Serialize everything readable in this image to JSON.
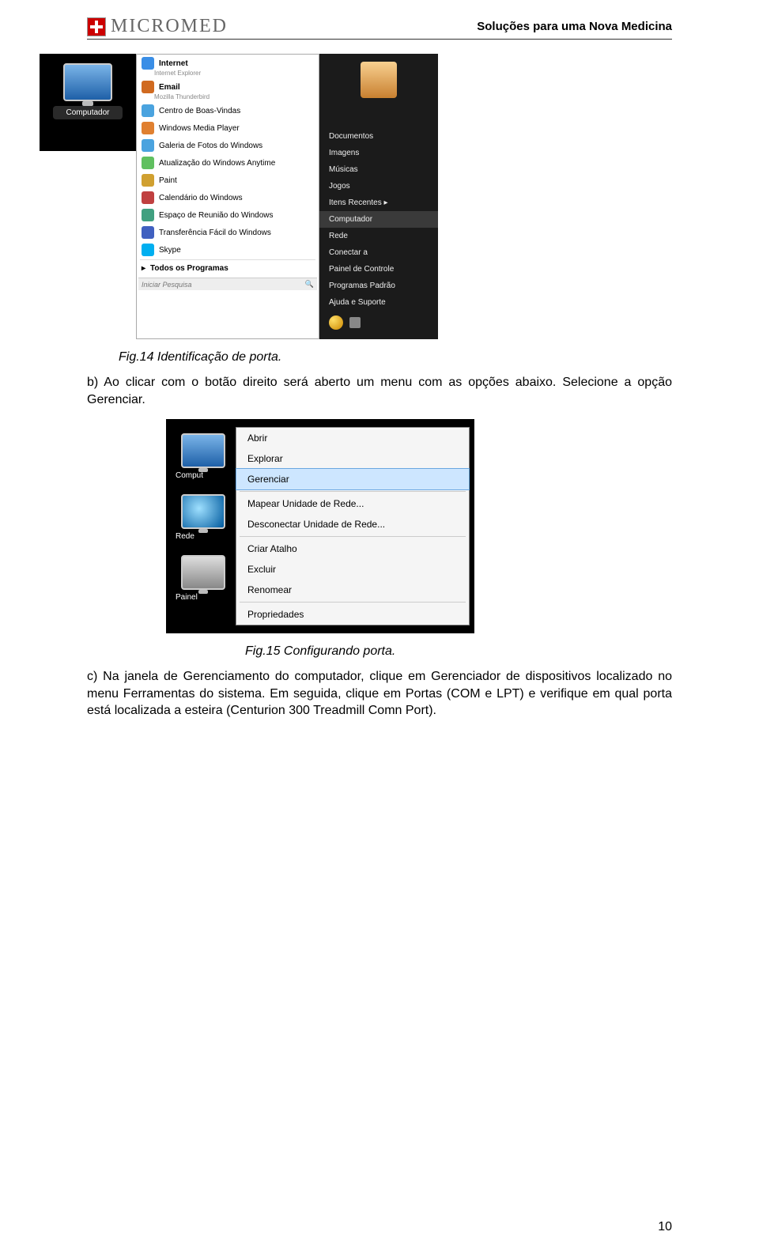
{
  "header": {
    "brand": "MICROMED",
    "tagline": "Soluções para uma Nova Medicina"
  },
  "fig14": {
    "sidebar_label": "Computador",
    "left_items": [
      {
        "title": "Internet",
        "sub": "Internet Explorer",
        "color": "#3a8ee6"
      },
      {
        "title": "Email",
        "sub": "Mozilla Thunderbird",
        "color": "#d06a20"
      },
      {
        "title": "Centro de Boas-Vindas",
        "color": "#4aa3df"
      },
      {
        "title": "Windows Media Player",
        "color": "#e08030"
      },
      {
        "title": "Galeria de Fotos do Windows",
        "color": "#4aa3df"
      },
      {
        "title": "Atualização do Windows Anytime",
        "color": "#60c060"
      },
      {
        "title": "Paint",
        "color": "#d0a030"
      },
      {
        "title": "Calendário do Windows",
        "color": "#c04040"
      },
      {
        "title": "Espaço de Reunião do Windows",
        "color": "#40a080"
      },
      {
        "title": "Transferência Fácil do Windows",
        "color": "#4060c0"
      },
      {
        "title": "Skype",
        "color": "#00aff0"
      }
    ],
    "all_programs": "Todos os Programas",
    "search_placeholder": "Iniciar Pesquisa",
    "right_items": [
      "Documentos",
      "Imagens",
      "Músicas",
      "Jogos",
      "Itens Recentes",
      "Computador",
      "Rede",
      "Conectar a",
      "Painel de Controle",
      "Programas Padrão",
      "Ajuda e Suporte"
    ],
    "right_selected_index": 5,
    "caption": "Fig.14 Identificação de porta."
  },
  "para_b": "b) Ao clicar com o botão direito será aberto um menu com as opções abaixo. Selecione a opção Gerenciar.",
  "fig15": {
    "left_labels": [
      "Comput",
      "Rede",
      "Painel"
    ],
    "ctx_groups": [
      [
        "Abrir",
        "Explorar",
        "Gerenciar"
      ],
      [
        "Mapear Unidade de Rede...",
        "Desconectar Unidade de Rede..."
      ],
      [
        "Criar Atalho",
        "Excluir",
        "Renomear"
      ],
      [
        "Propriedades"
      ]
    ],
    "ctx_hover": "Gerenciar",
    "caption": "Fig.15 Configurando porta."
  },
  "para_c": "c) Na janela de Gerenciamento do computador, clique em Gerenciador de dispositivos localizado no menu Ferramentas do sistema. Em seguida, clique em Portas (COM e LPT) e verifique em qual porta está localizada a esteira (Centurion 300 Treadmill Comn Port).",
  "page_number": "10"
}
